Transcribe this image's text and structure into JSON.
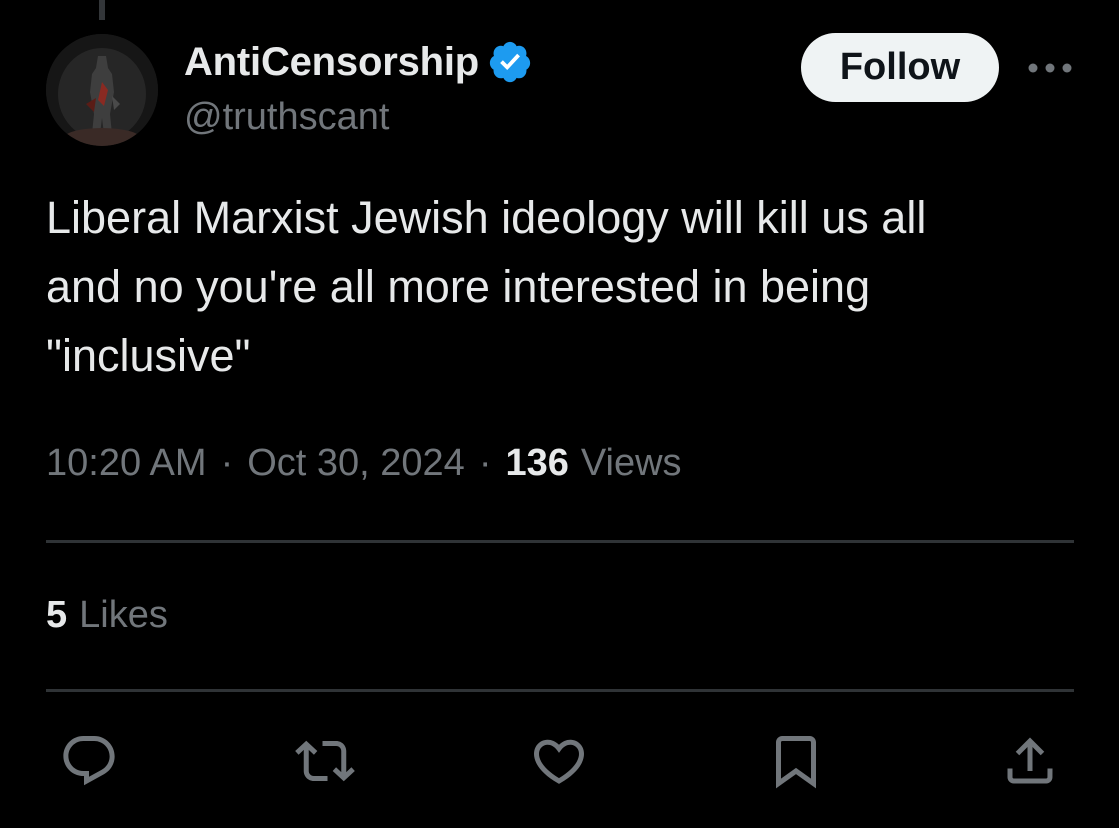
{
  "colors": {
    "background": "#000000",
    "primary_text": "#e7e9ea",
    "secondary_text": "#71767b",
    "verified_blue": "#1d9bf0",
    "divider": "#2f3336",
    "follow_bg": "#eff3f4"
  },
  "author": {
    "display_name": "AntiCensorship",
    "handle": "@truthscant",
    "verified_icon": "verified-badge-icon",
    "avatar_icon": "avatar-image"
  },
  "header": {
    "follow_label": "Follow",
    "more_icon": "more-options-icon"
  },
  "tweet": {
    "text": "Liberal Marxist Jewish ideology will kill us all\nand no you're all more interested in being\n\"inclusive\""
  },
  "meta": {
    "time": "10:20 AM",
    "separator": "·",
    "date": "Oct 30, 2024",
    "views_count": "136",
    "views_label": "Views"
  },
  "engagement": {
    "likes_count": "5",
    "likes_label": "Likes"
  },
  "actions": [
    {
      "icon": "reply-icon"
    },
    {
      "icon": "retweet-icon"
    },
    {
      "icon": "like-icon"
    },
    {
      "icon": "bookmark-icon"
    },
    {
      "icon": "share-icon"
    }
  ]
}
